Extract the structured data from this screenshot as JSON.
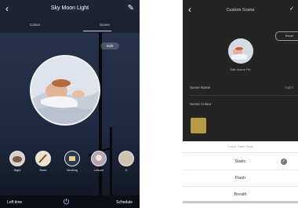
{
  "left": {
    "title": "Sky Moon Light",
    "back_icon": "chevron-left",
    "edit_icon": "pencil",
    "tabs": [
      {
        "label": "Colour"
      },
      {
        "label": "Scene"
      }
    ],
    "edit_pill": "Edit",
    "scenes": [
      {
        "label": "Night",
        "icon": "night-scene"
      },
      {
        "label": "Read",
        "icon": "read-scene"
      },
      {
        "label": "Working",
        "icon": "working-scene"
      },
      {
        "label": "Leisure",
        "icon": "leisure-scene"
      },
      {
        "label": "S",
        "icon": "scene"
      }
    ],
    "bottom": {
      "left_time": "Left time",
      "schedule": "Schedule",
      "power_icon": "power"
    }
  },
  "right": {
    "title": "Custom Scene",
    "back_icon": "chevron-left",
    "confirm_icon": "check",
    "reset_label": "Reset",
    "photo_label": "Edit Scene Pic",
    "scene_name_label": "Scene Name",
    "scene_name_value": "Night",
    "scene_colour_label": "Scene Colour",
    "swatch_color": "#b69a44",
    "sheet": {
      "title": "Colour Flash Mode",
      "options": [
        {
          "label": "Static",
          "selected": true
        },
        {
          "label": "Flash",
          "selected": false
        },
        {
          "label": "Breath",
          "selected": false
        }
      ]
    }
  }
}
